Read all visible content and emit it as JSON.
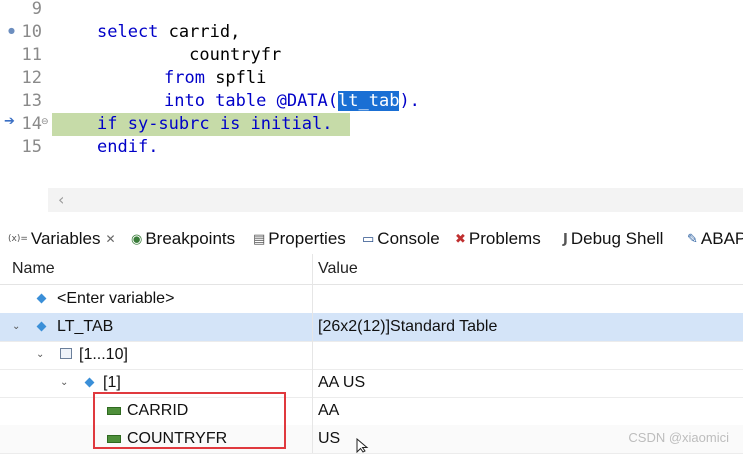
{
  "editor": {
    "lines": [
      {
        "num": "9",
        "code": ""
      },
      {
        "num": "10",
        "code_kw1": "select",
        "code_rest": " carrid,"
      },
      {
        "num": "11",
        "code": "         countryfr"
      },
      {
        "num": "12",
        "code_kw1": "from",
        "code_rest": " spfli"
      },
      {
        "num": "13",
        "code_kw1": "into table",
        "code_mid": " @DATA(",
        "code_sel": "lt_tab",
        "code_end": ")."
      },
      {
        "num": "14",
        "code_kw1": "if",
        "code_rest": " sy-subrc ",
        "code_kw2": "is initial",
        "code_end": "."
      },
      {
        "num": "15",
        "code_kw1": "endif",
        "code_end": "."
      }
    ]
  },
  "tabs": [
    {
      "label": "Variables",
      "icon": "variables-icon",
      "glyph": "(x)="
    },
    {
      "label": "Breakpoints",
      "icon": "breakpoints-icon",
      "glyph": "◉"
    },
    {
      "label": "Properties",
      "icon": "properties-icon",
      "glyph": "▤"
    },
    {
      "label": "Console",
      "icon": "console-icon",
      "glyph": "▭"
    },
    {
      "label": "Problems",
      "icon": "problems-icon",
      "glyph": "✖"
    },
    {
      "label": "Debug Shell",
      "icon": "debug-shell-icon",
      "glyph": "J"
    },
    {
      "label": "ABAP",
      "icon": "abap-icon",
      "glyph": "✎"
    }
  ],
  "table": {
    "col_name": "Name",
    "col_value": "Value",
    "rows": [
      {
        "name": "<Enter variable>",
        "value": ""
      },
      {
        "name": "LT_TAB",
        "value": "[26x2(12)]Standard Table"
      },
      {
        "name": "[1...10]",
        "value": ""
      },
      {
        "name": "[1]",
        "value": "AA US"
      },
      {
        "name": "CARRID",
        "value": "AA"
      },
      {
        "name": "COUNTRYFR",
        "value": "US"
      }
    ]
  },
  "watermark": "CSDN @xiaomici",
  "colors": {
    "keyword": "#0000c8",
    "selection": "#1a6fd4",
    "current_line": "#c6dba8",
    "annotation": "#e0393e"
  }
}
